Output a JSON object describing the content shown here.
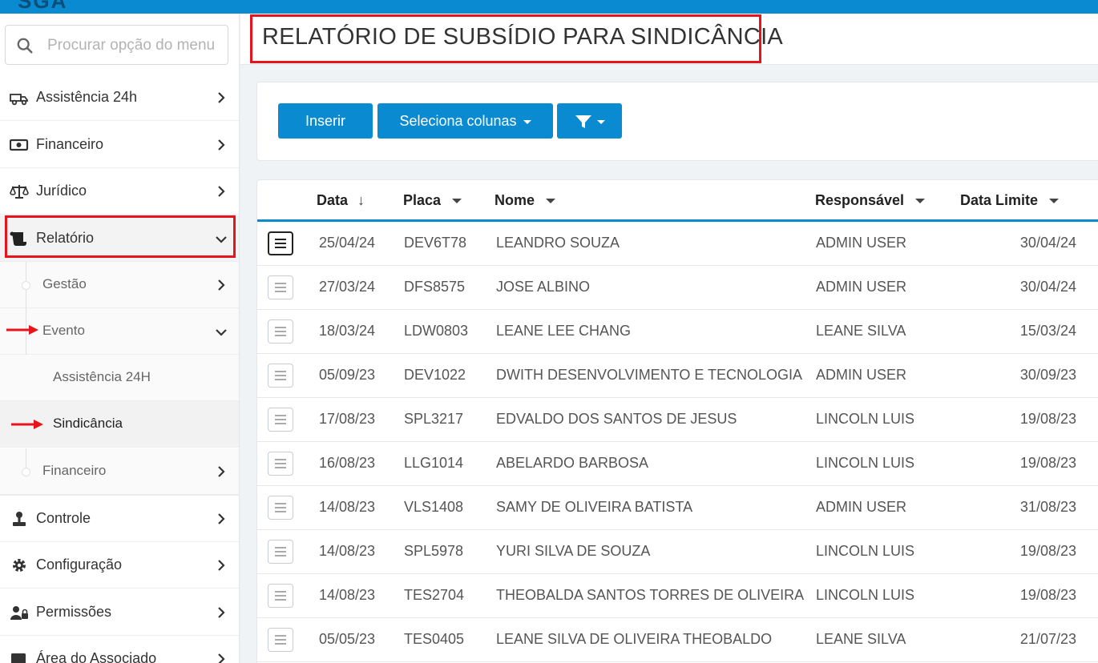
{
  "app": {
    "logo_text": "SGA"
  },
  "search": {
    "placeholder": "Procurar opção do menu"
  },
  "sidebar": {
    "items": [
      {
        "label": "Assistência 24h"
      },
      {
        "label": "Financeiro"
      },
      {
        "label": "Jurídico"
      },
      {
        "label": "Relatório"
      },
      {
        "label": "Controle"
      },
      {
        "label": "Configuração"
      },
      {
        "label": "Permissões"
      },
      {
        "label": "Área do Associado"
      }
    ],
    "sub_items": [
      {
        "label": "Gestão"
      },
      {
        "label": "Evento"
      },
      {
        "label": "Assistência 24H"
      },
      {
        "label": "Sindicância"
      },
      {
        "label": "Financeiro"
      }
    ]
  },
  "page": {
    "title": "RELATÓRIO DE SUBSÍDIO PARA SINDICÂNCIA"
  },
  "toolbar": {
    "insert_label": "Inserir",
    "columns_label": "Seleciona colunas"
  },
  "table": {
    "headers": [
      "Data",
      "Placa",
      "Nome",
      "Responsável",
      "Data Limite"
    ],
    "rows": [
      [
        "25/04/24",
        "DEV6T78",
        "LEANDRO SOUZA",
        "ADMIN USER",
        "30/04/24"
      ],
      [
        "27/03/24",
        "DFS8575",
        "JOSE ALBINO",
        "ADMIN USER",
        "30/04/24"
      ],
      [
        "18/03/24",
        "LDW0803",
        "LEANE LEE CHANG",
        "LEANE SILVA",
        "15/03/24"
      ],
      [
        "05/09/23",
        "DEV1022",
        "DWITH DESENVOLVIMENTO E TECNOLOGIA",
        "ADMIN USER",
        "30/09/23"
      ],
      [
        "17/08/23",
        "SPL3217",
        "EDVALDO DOS SANTOS DE JESUS",
        "LINCOLN LUIS",
        "19/08/23"
      ],
      [
        "16/08/23",
        "LLG1014",
        "ABELARDO BARBOSA",
        "LINCOLN LUIS",
        "19/08/23"
      ],
      [
        "14/08/23",
        "VLS1408",
        "SAMY DE OLIVEIRA BATISTA",
        "ADMIN USER",
        "31/08/23"
      ],
      [
        "14/08/23",
        "SPL5978",
        "YURI SILVA DE SOUZA",
        "LINCOLN LUIS",
        "19/08/23"
      ],
      [
        "14/08/23",
        "TES2704",
        "THEOBALDA SANTOS TORRES DE OLIVEIRA",
        "LINCOLN LUIS",
        "19/08/23"
      ],
      [
        "05/05/23",
        "TES0405",
        "LEANE SILVA DE OLIVEIRA THEOBALDO",
        "LEANE SILVA",
        "21/07/23"
      ]
    ]
  },
  "colors": {
    "primary": "#0a8ad0",
    "highlight": "#e8141b"
  }
}
